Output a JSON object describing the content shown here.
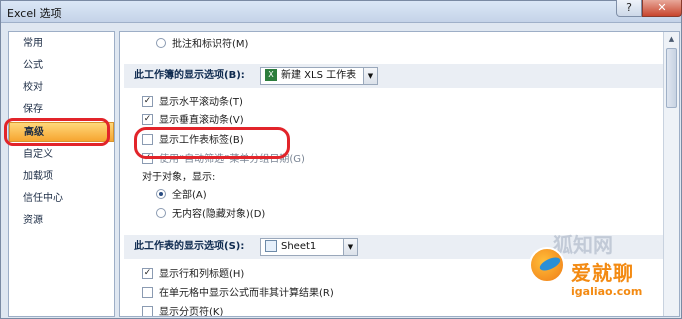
{
  "window": {
    "title": "Excel 选项",
    "help_glyph": "?",
    "close_glyph": "✕"
  },
  "sidebar": {
    "items": [
      {
        "label": "常用"
      },
      {
        "label": "公式"
      },
      {
        "label": "校对"
      },
      {
        "label": "保存"
      },
      {
        "label": "高级"
      },
      {
        "label": "自定义"
      },
      {
        "label": "加载项"
      },
      {
        "label": "信任中心"
      },
      {
        "label": "资源"
      }
    ],
    "active_index": 4
  },
  "content": {
    "top_radio_label": "批注和标识符(M)",
    "workbook_section": {
      "label": "此工作簿的显示选项(B):",
      "combo_value": "新建 XLS 工作表",
      "combo_icon": "excel-file-icon"
    },
    "workbook_options": [
      {
        "label": "显示水平滚动条(T)",
        "checked": true
      },
      {
        "label": "显示垂直滚动条(V)",
        "checked": true
      },
      {
        "label": "显示工作表标签(B)",
        "checked": false
      },
      {
        "label": "使用“自动筛选”菜单分组日期(G)",
        "checked": true
      }
    ],
    "objects_label": "对于对象，显示:",
    "object_radios": [
      {
        "label": "全部(A)",
        "selected": true
      },
      {
        "label": "无内容(隐藏对象)(D)",
        "selected": false
      }
    ],
    "worksheet_section": {
      "label": "此工作表的显示选项(S):",
      "combo_value": "Sheet1",
      "combo_icon": "sheet-icon"
    },
    "worksheet_options": [
      {
        "label": "显示行和列标题(H)",
        "checked": true
      },
      {
        "label": "在单元格中显示公式而非其计算结果(R)",
        "checked": false
      },
      {
        "label": "显示分页符(K)",
        "checked": false
      }
    ]
  },
  "watermark": {
    "faint_text": "狐知网",
    "text_main": "爱就聊",
    "text_url": "igaliao.com"
  },
  "colors": {
    "highlight": "#e2242a",
    "active_nav": "#f6a531",
    "watermark": "#f38a12"
  }
}
